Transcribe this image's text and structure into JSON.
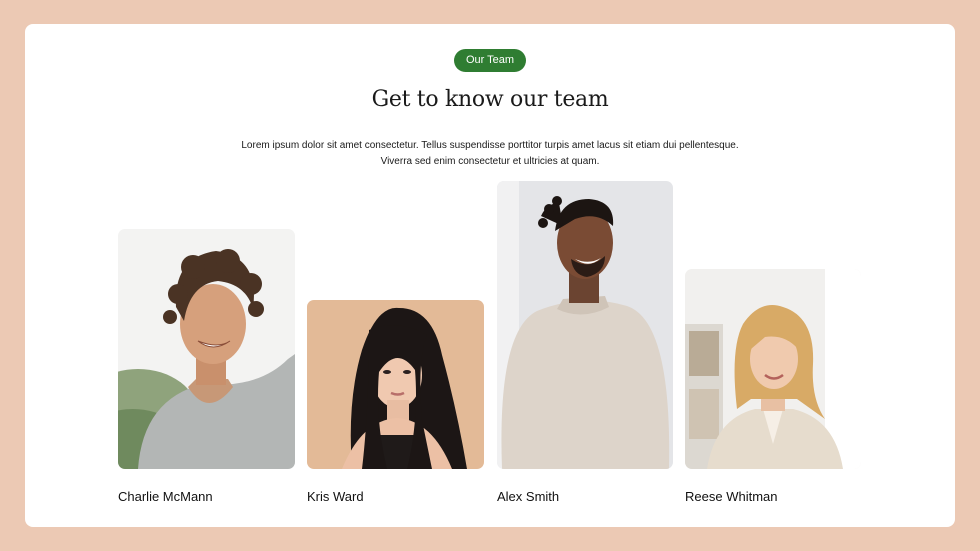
{
  "header": {
    "badge": "Our Team",
    "title": "Get to know our team",
    "description_line1": "Lorem ipsum dolor sit amet consectetur. Tellus suspendisse porttitor turpis amet lacus sit etiam dui pellentesque.",
    "description_line2": "Viverra sed enim consectetur et ultricies at quam."
  },
  "members": [
    {
      "name": "Charlie McMann"
    },
    {
      "name": "Kris Ward"
    },
    {
      "name": "Alex Smith"
    },
    {
      "name": "Reese Whitman"
    }
  ],
  "colors": {
    "page_background": "#ecc9b4",
    "card_background": "#ffffff",
    "badge": "#2f7d32"
  }
}
